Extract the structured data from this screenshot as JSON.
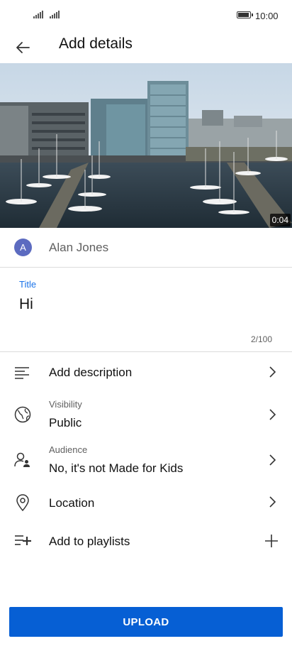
{
  "status_bar": {
    "time": "10:00"
  },
  "header": {
    "title": "Add details"
  },
  "video": {
    "duration": "0:04"
  },
  "account": {
    "initial": "A",
    "name": "Alan Jones"
  },
  "title_field": {
    "label": "Title",
    "value": "Hi",
    "char_count": "2/100"
  },
  "details": [
    {
      "label": "Add description"
    },
    {
      "label": "Public",
      "sublabel": "Visibility"
    },
    {
      "label": "No, it's not Made for Kids",
      "sublabel": "Audience"
    },
    {
      "label": "Location"
    },
    {
      "label": "Add to playlists"
    }
  ],
  "upload": {
    "label": "UPLOAD"
  },
  "colors": {
    "accent": "#065fd4",
    "link": "#1a73e8",
    "avatar": "#5c6bc0"
  }
}
